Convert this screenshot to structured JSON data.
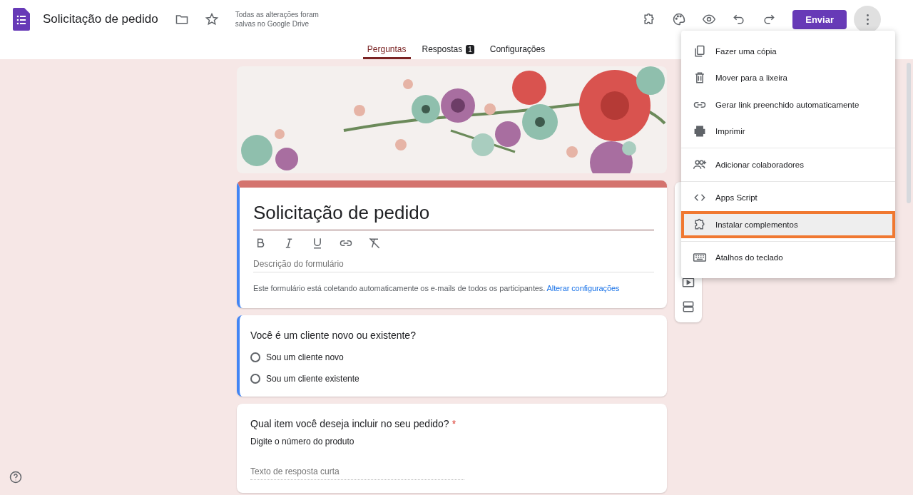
{
  "header": {
    "title": "Solicitação de pedido",
    "save_status": "Todas as alterações foram salvas no Google Drive",
    "send_button": "Enviar"
  },
  "tabs": [
    {
      "label": "Perguntas",
      "selected": true
    },
    {
      "label": "Respostas",
      "selected": false,
      "badge": "1"
    },
    {
      "label": "Configurações",
      "selected": false
    }
  ],
  "form_header": {
    "title": "Solicitação de pedido",
    "description_placeholder": "Descrição do formulário",
    "notice": "Este formulário está coletando automaticamente os e-mails de todos os participantes.",
    "notice_link": "Alterar configurações"
  },
  "questions": [
    {
      "kind": "radio",
      "title": "Você é um cliente novo ou existente?",
      "options": [
        {
          "label": "Sou um cliente novo",
          "selected": false
        },
        {
          "label": "Sou um cliente existente",
          "selected": false
        }
      ]
    },
    {
      "kind": "short",
      "title": "Qual item você deseja incluir no seu pedido?",
      "required_mark": "*",
      "description": "Digite o número do produto",
      "placeholder": "Texto de resposta curta"
    }
  ],
  "menu": {
    "sections": [
      [
        {
          "label": "Fazer uma cópia",
          "selected": false
        },
        {
          "label": "Mover para a lixeira",
          "selected": false
        },
        {
          "label": "Gerar link preenchido automaticamente",
          "selected": false
        },
        {
          "label": "Imprimir",
          "selected": false
        }
      ],
      [
        {
          "label": "Adicionar colaboradores",
          "selected": false
        }
      ],
      [
        {
          "label": "Apps Script",
          "selected": false
        },
        {
          "label": "Instalar complementos",
          "selected": true
        }
      ],
      [
        {
          "label": "Atalhos do teclado",
          "selected": false
        }
      ]
    ]
  }
}
